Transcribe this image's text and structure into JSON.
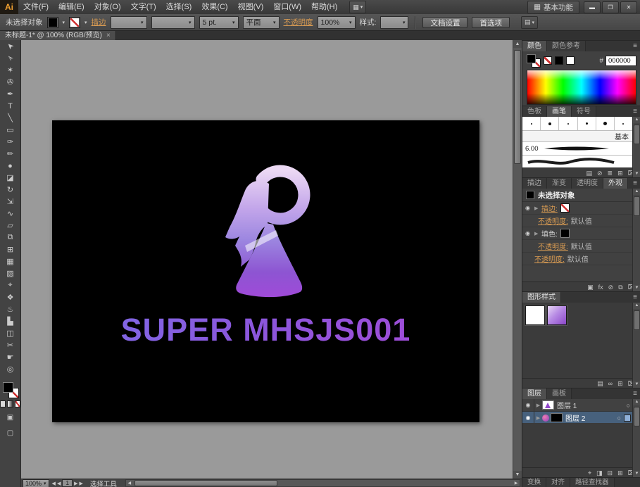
{
  "window": {
    "logo": "Ai",
    "workspace": "基本功能",
    "min": "▬",
    "restore": "❒",
    "close": "✕"
  },
  "glyphs": {
    "caret": "▾",
    "caret_up": "▴",
    "menu": "≡",
    "eye": "◉",
    "disclosure": "▶",
    "target": "○",
    "scroll_up": "▲",
    "scroll_down": "▼",
    "scroll_left": "◀",
    "scroll_right": "▶",
    "nav_prev": "◀",
    "nav_next": "▶",
    "arrange_documents": "▦",
    "workspace_icon": "▦",
    "extra_tools": "▤",
    "fx": "fx"
  },
  "menus": [
    "文件(F)",
    "编辑(E)",
    "对象(O)",
    "文字(T)",
    "选择(S)",
    "效果(C)",
    "视图(V)",
    "窗口(W)",
    "帮助(H)"
  ],
  "control": {
    "no_selection": "未选择对象",
    "stroke_label": "描边",
    "stroke_width": "5 pt.",
    "profile": "平面",
    "opacity_label": "不透明度",
    "opacity_value": "100%",
    "style_label": "样式:",
    "doc_setup": "文档设置",
    "preferences": "首选项"
  },
  "doc_tab": {
    "title": "未标题-1* @ 100% (RGB/预览)",
    "close": "×"
  },
  "tools": [
    {
      "name": "selection-tool",
      "glyph": "➤",
      "rot": -135
    },
    {
      "name": "direct-selection-tool",
      "glyph": "➢",
      "rot": -135
    },
    {
      "name": "magic-wand-tool",
      "glyph": "✶"
    },
    {
      "name": "lasso-tool",
      "glyph": "✇"
    },
    {
      "name": "pen-tool",
      "glyph": "✒"
    },
    {
      "name": "type-tool",
      "glyph": "T"
    },
    {
      "name": "line-segment-tool",
      "glyph": "╲"
    },
    {
      "name": "rectangle-tool",
      "glyph": "▭"
    },
    {
      "name": "paintbrush-tool",
      "glyph": "✑"
    },
    {
      "name": "pencil-tool",
      "glyph": "✏"
    },
    {
      "name": "blob-brush-tool",
      "glyph": "●"
    },
    {
      "name": "eraser-tool",
      "glyph": "◪"
    },
    {
      "name": "rotate-tool",
      "glyph": "↻"
    },
    {
      "name": "scale-tool",
      "glyph": "⇲"
    },
    {
      "name": "width-tool",
      "glyph": "∿"
    },
    {
      "name": "free-transform-tool",
      "glyph": "▱"
    },
    {
      "name": "shape-builder-tool",
      "glyph": "⧉"
    },
    {
      "name": "perspective-grid-tool",
      "glyph": "⊞"
    },
    {
      "name": "mesh-tool",
      "glyph": "▦"
    },
    {
      "name": "gradient-tool",
      "glyph": "▧"
    },
    {
      "name": "eyedropper-tool",
      "glyph": "⌖"
    },
    {
      "name": "blend-tool",
      "glyph": "❖"
    },
    {
      "name": "symbol-sprayer-tool",
      "glyph": "♨"
    },
    {
      "name": "column-graph-tool",
      "glyph": "▙"
    },
    {
      "name": "artboard-tool",
      "glyph": "◫"
    },
    {
      "name": "slice-tool",
      "glyph": "✂"
    },
    {
      "name": "hand-tool",
      "glyph": "☛"
    },
    {
      "name": "zoom-tool",
      "glyph": "◎"
    }
  ],
  "artboard": {
    "logo_text": "SUPER MHSJS001"
  },
  "panels": {
    "color": {
      "tabs": [
        "颜色",
        "颜色参考"
      ],
      "active": 0,
      "hex_prefix": "#",
      "hex": "000000"
    },
    "brushes": {
      "tabs": [
        "色板",
        "画笔",
        "符号"
      ],
      "active": 1,
      "dot_sizes": [
        2,
        4,
        2,
        3,
        5,
        2
      ],
      "basic_label": "基本",
      "calligraphic_size": "6.00",
      "icons": [
        {
          "name": "brush-libraries-icon",
          "glyph": "▤"
        },
        {
          "name": "remove-brush-stroke-icon",
          "glyph": "⊘"
        },
        {
          "name": "brush-options-icon",
          "glyph": "≣"
        },
        {
          "name": "new-brush-icon",
          "glyph": "⊞"
        },
        {
          "name": "delete-brush-icon",
          "glyph": "⌧"
        }
      ]
    },
    "appearance": {
      "group_tabs": [
        "描边",
        "渐变",
        "透明度"
      ],
      "tab": "外观",
      "header": "未选择对象",
      "rows": [
        {
          "type": "stroke",
          "label": "描边:",
          "link": true,
          "eye": true,
          "swatch": "none",
          "indent": 0
        },
        {
          "type": "opacity",
          "label": "不透明度:",
          "link": true,
          "value": "默认值",
          "indent": 1
        },
        {
          "type": "fill",
          "label": "填色:",
          "link": false,
          "eye": true,
          "swatch": "black",
          "indent": 0
        },
        {
          "type": "opacity",
          "label": "不透明度:",
          "link": true,
          "value": "默认值",
          "indent": 1
        },
        {
          "type": "opacity",
          "label": "不透明度:",
          "link": true,
          "value": "默认值",
          "indent": 0
        }
      ],
      "icons": [
        {
          "name": "new-stroke-icon",
          "glyph": "▣"
        },
        {
          "name": "new-effect-icon",
          "glyph": "fx"
        },
        {
          "name": "clear-appearance-icon",
          "glyph": "⊘"
        },
        {
          "name": "duplicate-item-icon",
          "glyph": "⧉"
        },
        {
          "name": "delete-item-icon",
          "glyph": "⌧"
        }
      ]
    },
    "graphic_styles": {
      "tab": "图形样式",
      "icons": [
        {
          "name": "style-libraries-icon",
          "glyph": "▤"
        },
        {
          "name": "break-link-icon",
          "glyph": "∞"
        },
        {
          "name": "new-style-icon",
          "glyph": "⊞"
        },
        {
          "name": "delete-style-icon",
          "glyph": "⌧"
        }
      ]
    },
    "layers": {
      "tabs": [
        "图层",
        "画板"
      ],
      "active": 0,
      "rows": [
        {
          "name": "图层 1",
          "selected": false,
          "thumb": "logo",
          "blob": false
        },
        {
          "name": "图层 2",
          "selected": true,
          "thumb": "black",
          "blob": true
        }
      ],
      "icons": [
        {
          "name": "locate-object-icon",
          "glyph": "⌖"
        },
        {
          "name": "make-clip-mask-icon",
          "glyph": "◨"
        },
        {
          "name": "new-sublayer-icon",
          "glyph": "⊟"
        },
        {
          "name": "new-layer-icon",
          "glyph": "⊞"
        },
        {
          "name": "delete-layer-icon",
          "glyph": "⌧"
        }
      ]
    },
    "bottom_tabs": [
      "变换",
      "对齐",
      "路径查找器"
    ]
  },
  "status": {
    "zoom": "100%",
    "artboard_num": "1",
    "tool": "选择工具"
  },
  "brand_colors": {
    "logo_gradient_top": "#e8d4f2",
    "logo_gradient_bottom": "#9a46cc",
    "link_orange": "#d79a52"
  }
}
